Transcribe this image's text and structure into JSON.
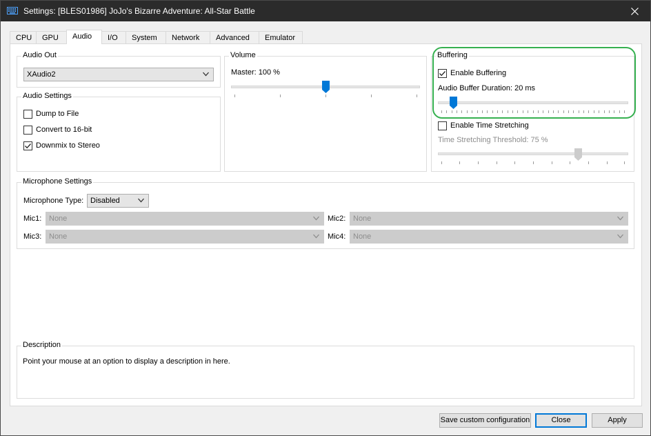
{
  "window": {
    "title": "Settings: [BLES01986] JoJo's Bizarre Adventure: All-Star Battle",
    "app_icon": "keyboard-icon",
    "close_icon": "close-icon"
  },
  "tabs": [
    {
      "label": "CPU"
    },
    {
      "label": "GPU"
    },
    {
      "label": "Audio",
      "active": true
    },
    {
      "label": "I/O"
    },
    {
      "label": "System"
    },
    {
      "label": "Network"
    },
    {
      "label": "Advanced"
    },
    {
      "label": "Emulator"
    }
  ],
  "audio_out": {
    "legend": "Audio Out",
    "selected": "XAudio2"
  },
  "audio_settings": {
    "legend": "Audio Settings",
    "options": [
      {
        "label": "Dump to File",
        "checked": false
      },
      {
        "label": "Convert to 16-bit",
        "checked": false
      },
      {
        "label": "Downmix to Stereo",
        "checked": true
      }
    ]
  },
  "volume": {
    "legend": "Volume",
    "master_label": "Master: 100 %",
    "master_value_fraction": 0.5
  },
  "buffering": {
    "legend": "Buffering",
    "enable_buffering": {
      "label": "Enable Buffering",
      "checked": true
    },
    "duration_label": "Audio Buffer Duration: 20 ms",
    "duration_value_fraction": 0.08,
    "enable_time_stretching": {
      "label": "Enable Time Stretching",
      "checked": false
    },
    "threshold_label": "Time Stretching Threshold: 75 %",
    "threshold_value_fraction": 0.75
  },
  "microphone": {
    "legend": "Microphone Settings",
    "type_label": "Microphone Type:",
    "type_selected": "Disabled",
    "mics": [
      {
        "label": "Mic1:",
        "value": "None"
      },
      {
        "label": "Mic2:",
        "value": "None"
      },
      {
        "label": "Mic3:",
        "value": "None"
      },
      {
        "label": "Mic4:",
        "value": "None"
      }
    ]
  },
  "description": {
    "legend": "Description",
    "text": "Point your mouse at an option to display a description in here."
  },
  "buttons": {
    "save_custom": "Save custom configuration",
    "close": "Close",
    "apply": "Apply"
  },
  "colors": {
    "accent": "#0078d7",
    "highlight_ring": "#35b04f",
    "titlebar": "#2b2b2b"
  }
}
